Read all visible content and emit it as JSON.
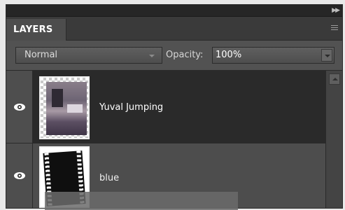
{
  "panel": {
    "title": "LAYERS",
    "blend_mode": "Normal",
    "opacity_label": "Opacity:",
    "opacity_value": "100%"
  },
  "layers": [
    {
      "name": "Yuval Jumping",
      "visible": true,
      "selected": true
    },
    {
      "name": "blue",
      "visible": true,
      "selected": false
    }
  ],
  "icons": {
    "collapse": "double-chevron-right-icon",
    "panel_menu": "menu-icon",
    "visibility": "eye-icon"
  }
}
